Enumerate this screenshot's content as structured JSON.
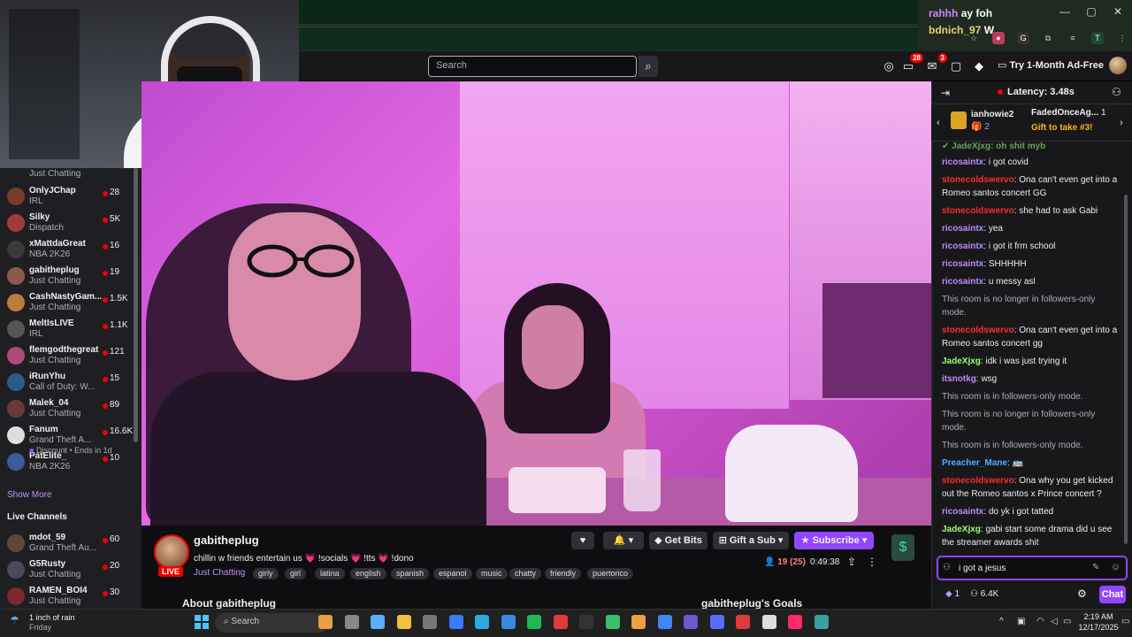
{
  "overlay_chat": [
    {
      "user": "rahhh",
      "text": "ay foh"
    },
    {
      "user": "bdnich_97",
      "text": "W"
    }
  ],
  "nav": {
    "search_placeholder": "Search",
    "badge_notifications": "28",
    "badge_inbox": "3",
    "ad_free_label": "Try 1-Month Ad-Free"
  },
  "sidebar": {
    "top_game": "Just Chatting",
    "channels": [
      {
        "name": "OnlyJChap",
        "game": "IRL",
        "viewers": "28",
        "avatar_color": "#7a3b2a"
      },
      {
        "name": "Silky",
        "game": "Dispatch",
        "viewers": "5K",
        "avatar_color": "#a33a3a"
      },
      {
        "name": "xMattdaGreat",
        "game": "NBA 2K26",
        "viewers": "16",
        "avatar_color": "#3a3a3a"
      },
      {
        "name": "gabitheplug",
        "game": "Just Chatting",
        "viewers": "19",
        "avatar_color": "#8a5a4a"
      },
      {
        "name": "CashNastyGam...",
        "game": "Just Chatting",
        "viewers": "1.5K",
        "avatar_color": "#c07a3a"
      },
      {
        "name": "MeltIsLIVE",
        "game": "IRL",
        "viewers": "1.1K",
        "avatar_color": "#555555"
      },
      {
        "name": "flemgodthegreat",
        "game": "Just Chatting",
        "viewers": "121",
        "avatar_color": "#b04a7a"
      },
      {
        "name": "iRunYhu",
        "game": "Call of Duty: W...",
        "viewers": "15",
        "avatar_color": "#2a5a8a"
      },
      {
        "name": "Malek_04",
        "game": "Just Chatting",
        "viewers": "89",
        "avatar_color": "#6a3a3a"
      },
      {
        "name": "Fanum",
        "game": "Grand Theft A...",
        "viewers": "16.6K",
        "avatar_color": "#dddddd"
      },
      {
        "name": "PatElite_",
        "game": "NBA 2K26",
        "viewers": "10",
        "avatar_color": "#3a5a9a"
      }
    ],
    "fanum_promo": "Discount • Ends in 1d",
    "show_more": "Show More",
    "live_channels_heading": "Live Channels",
    "live_channels": [
      {
        "name": "mdot_59",
        "game": "Grand Theft Au...",
        "viewers": "60",
        "avatar_color": "#5a4a3a"
      },
      {
        "name": "G5Rusty",
        "game": "Just Chatting",
        "viewers": "20",
        "avatar_color": "#4a4a5a"
      },
      {
        "name": "RAMEN_BOI4",
        "game": "Just Chatting",
        "viewers": "30",
        "avatar_color": "#7a2a2a"
      }
    ]
  },
  "stream": {
    "channel": "gabitheplug",
    "live_label": "LIVE",
    "title": "chillin w friends entertain us 💗 !socials 💗 !tts 💗 !dono",
    "category": "Just Chatting",
    "tags": [
      "girly",
      "girl",
      "latina",
      "english",
      "spanish",
      "espanol",
      "music",
      "chatty",
      "friendly",
      "puertorico"
    ],
    "viewers": "19 (25)",
    "uptime": "0:49:38",
    "get_bits": "Get Bits",
    "gift_sub": "Gift a Sub",
    "subscribe": "Subscribe",
    "about": "About gabitheplug",
    "goals": "gabitheplug's Goals"
  },
  "chat": {
    "latency": "Latency: 3.48s",
    "gifters": {
      "first_name": "ianhowie2",
      "first_count": "2",
      "second_name": "FadedOnceAg...",
      "second_count": "1",
      "gift_cta": "Gift to take #3!"
    },
    "messages": [
      {
        "user": "ricosaintx",
        "color": "#b98cff",
        "text": "i got covid"
      },
      {
        "user": "stonecoldswervo",
        "color": "#ff2a2a",
        "text": "Ona can't even get into a Romeo santos concert GG"
      },
      {
        "user": "stonecoldswervo",
        "color": "#ff2a2a",
        "text": "she had to ask Gabi"
      },
      {
        "user": "ricosaintx",
        "color": "#b98cff",
        "text": "yea"
      },
      {
        "user": "ricosaintx",
        "color": "#b98cff",
        "text": "i got it frm school"
      },
      {
        "user": "ricosaintx",
        "color": "#b98cff",
        "text": "SHHHHH"
      },
      {
        "user": "ricosaintx",
        "color": "#b98cff",
        "text": "u messy asl"
      },
      {
        "system": "This room is no longer in followers-only mode."
      },
      {
        "user": "stonecoldswervo",
        "color": "#ff2a2a",
        "text": "Ona can't even get into a Romeo santos concert gg"
      },
      {
        "user": "JadeXjxg",
        "color": "#9aff7a",
        "text": "idk i was just trying it"
      },
      {
        "user": "itsnotkg",
        "color": "#b98cff",
        "text": "wsg"
      },
      {
        "system": "This room is in followers-only mode."
      },
      {
        "system": "This room is no longer in followers-only mode."
      },
      {
        "system": "This room is in followers-only mode."
      },
      {
        "user": "Preacher_Mane",
        "color": "#4ab0ff",
        "text": "🚌"
      },
      {
        "user": "stonecoldswervo",
        "color": "#ff2a2a",
        "text": "Ona why you get kicked out the Romeo santos x Prince concert ?"
      },
      {
        "user": "ricosaintx",
        "color": "#b98cff",
        "text": "do yk i got tatted"
      },
      {
        "user": "JadeXjxg",
        "color": "#9aff7a",
        "text": "gabi start some drama did u see the streamer awards shit"
      }
    ],
    "input_value": "i got a jesus",
    "points": "1",
    "channel_points": "6.4K",
    "send_label": "Chat"
  },
  "taskbar": {
    "weather": "1 inch of rain",
    "weather_day": "Friday",
    "search": "Search",
    "time": "2:19 AM",
    "date": "12/17/2025"
  }
}
